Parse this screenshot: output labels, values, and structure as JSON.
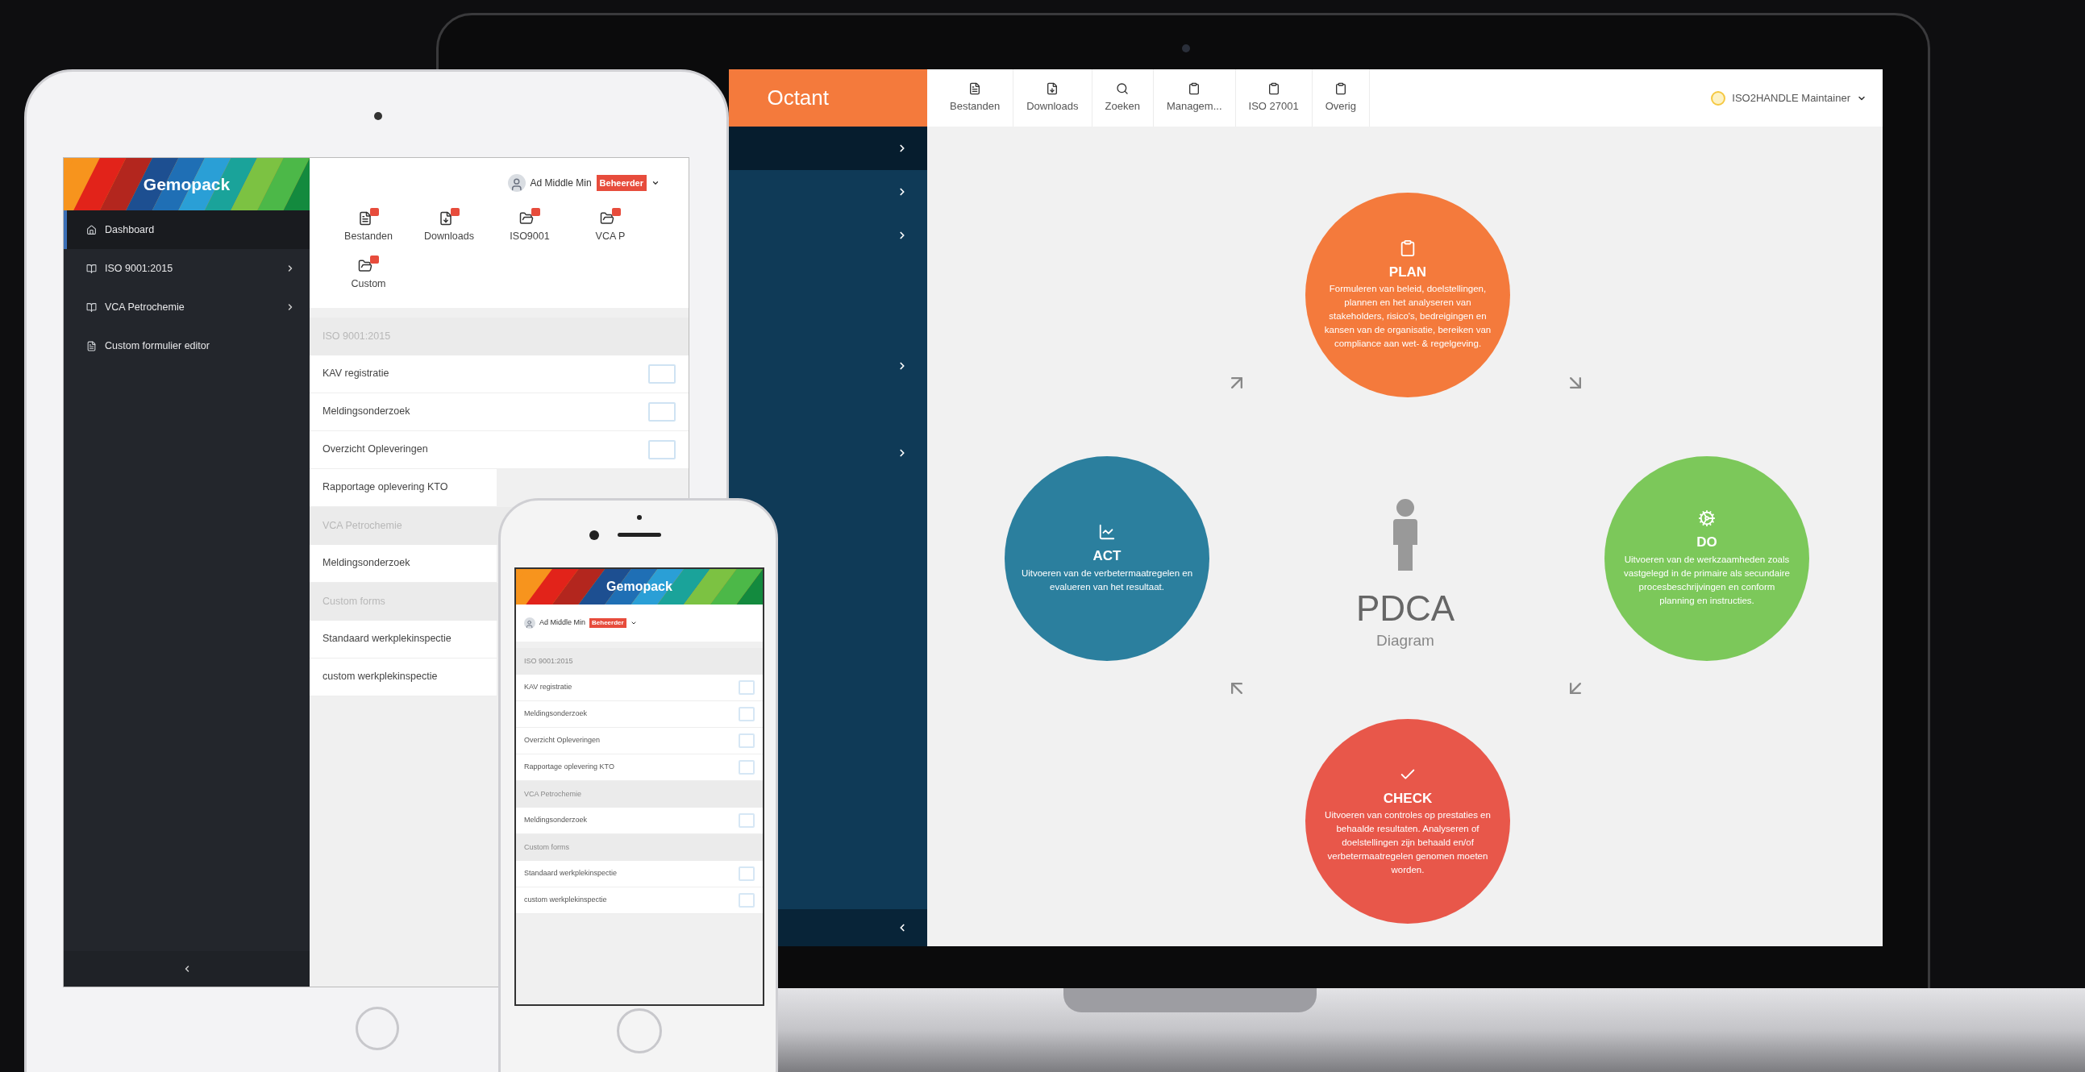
{
  "laptop": {
    "brand": "Octant",
    "sidebar": [
      {
        "selected": true
      },
      {
        "selected": false
      },
      {
        "selected": false
      },
      {
        "selected": false
      },
      {
        "selected": false
      }
    ],
    "toolbar": [
      {
        "label": "Bestanden",
        "kind": "file"
      },
      {
        "label": "Downloads",
        "kind": "download"
      },
      {
        "label": "Zoeken",
        "kind": "search"
      },
      {
        "label": "Managem...",
        "kind": "clipboard"
      },
      {
        "label": "ISO 27001",
        "kind": "clipboard"
      },
      {
        "label": "Overig",
        "kind": "clipboard"
      }
    ],
    "user": "ISO2HANDLE Maintainer",
    "diagram": {
      "title": "PDCA",
      "subtitle": "Diagram",
      "phases": [
        {
          "kind": "plan",
          "title": "PLAN",
          "color": "#f47a3c",
          "text": "Formuleren van beleid, doelstellingen, plannen en het analyseren van stakeholders, risico's, bedreigingen en kansen van de organisatie, bereiken van compliance aan wet- & regelgeving."
        },
        {
          "kind": "do",
          "title": "DO",
          "color": "#7cc85a",
          "text": "Uitvoeren van de werkzaamheden zoals vastgelegd in de primaire als secundaire procesbeschrijvingen en conform planning en instructies."
        },
        {
          "kind": "check",
          "title": "CHECK",
          "color": "#e8574a",
          "text": "Uitvoeren van controles op prestaties en behaalde resultaten. Analyseren of doelstellingen zijn behaald en/of verbetermaatregelen genomen moeten worden."
        },
        {
          "kind": "act",
          "title": "ACT",
          "color": "#2b7f9e",
          "text": "Uitvoeren van de verbetermaatregelen en evalueren van het resultaat."
        }
      ]
    }
  },
  "tablet": {
    "brand": "Gemopack",
    "menu": [
      {
        "label": "Dashboard",
        "kind": "home",
        "selected": true,
        "has_submenu": false
      },
      {
        "label": "ISO 9001:2015",
        "kind": "book",
        "selected": false,
        "has_submenu": true
      },
      {
        "label": "VCA Petrochemie",
        "kind": "book",
        "selected": false,
        "has_submenu": true
      },
      {
        "label": "Custom formulier editor",
        "kind": "file",
        "selected": false,
        "has_submenu": false
      }
    ],
    "user": {
      "name": "Ad Middle Min",
      "role": "Beheerder"
    },
    "shortcuts": [
      {
        "label": "Bestanden",
        "kind": "file"
      },
      {
        "label": "Downloads",
        "kind": "download"
      },
      {
        "label": "ISO9001",
        "kind": "folder"
      },
      {
        "label": "VCA P",
        "kind": "folder"
      },
      {
        "label": "Custom",
        "kind": "folder"
      }
    ],
    "list": [
      {
        "kind": "section",
        "label": "ISO 9001:2015"
      },
      {
        "kind": "form",
        "label": "KAV registratie",
        "action_visible": true
      },
      {
        "kind": "form",
        "label": "Meldingsonderzoek",
        "action_visible": true
      },
      {
        "kind": "form",
        "label": "Overzicht Opleveringen",
        "action_visible": true
      },
      {
        "kind": "form",
        "label": "Rapportage oplevering KTO",
        "action_visible": false
      },
      {
        "kind": "section",
        "label": "VCA Petrochemie"
      },
      {
        "kind": "form",
        "label": "Meldingsonderzoek",
        "action_visible": false
      },
      {
        "kind": "section",
        "label": "Custom forms"
      },
      {
        "kind": "form",
        "label": "Standaard werkplekinspectie",
        "action_visible": false
      },
      {
        "kind": "form",
        "label": "custom werkplekinspectie",
        "action_visible": false
      }
    ]
  },
  "phone": {
    "brand": "Gemopack",
    "user": {
      "name": "Ad Middle Min",
      "role": "Beheerder"
    },
    "list": [
      {
        "kind": "section",
        "label": "ISO 9001:2015"
      },
      {
        "kind": "form",
        "label": "KAV registratie"
      },
      {
        "kind": "form",
        "label": "Meldingsonderzoek"
      },
      {
        "kind": "form",
        "label": "Overzicht Opleveringen"
      },
      {
        "kind": "form",
        "label": "Rapportage oplevering KTO"
      },
      {
        "kind": "section",
        "label": "VCA Petrochemie"
      },
      {
        "kind": "form",
        "label": "Meldingsonderzoek"
      },
      {
        "kind": "section",
        "label": "Custom forms"
      },
      {
        "kind": "form",
        "label": "Standaard werkplekinspectie"
      },
      {
        "kind": "form",
        "label": "custom werkplekinspectie"
      }
    ]
  }
}
